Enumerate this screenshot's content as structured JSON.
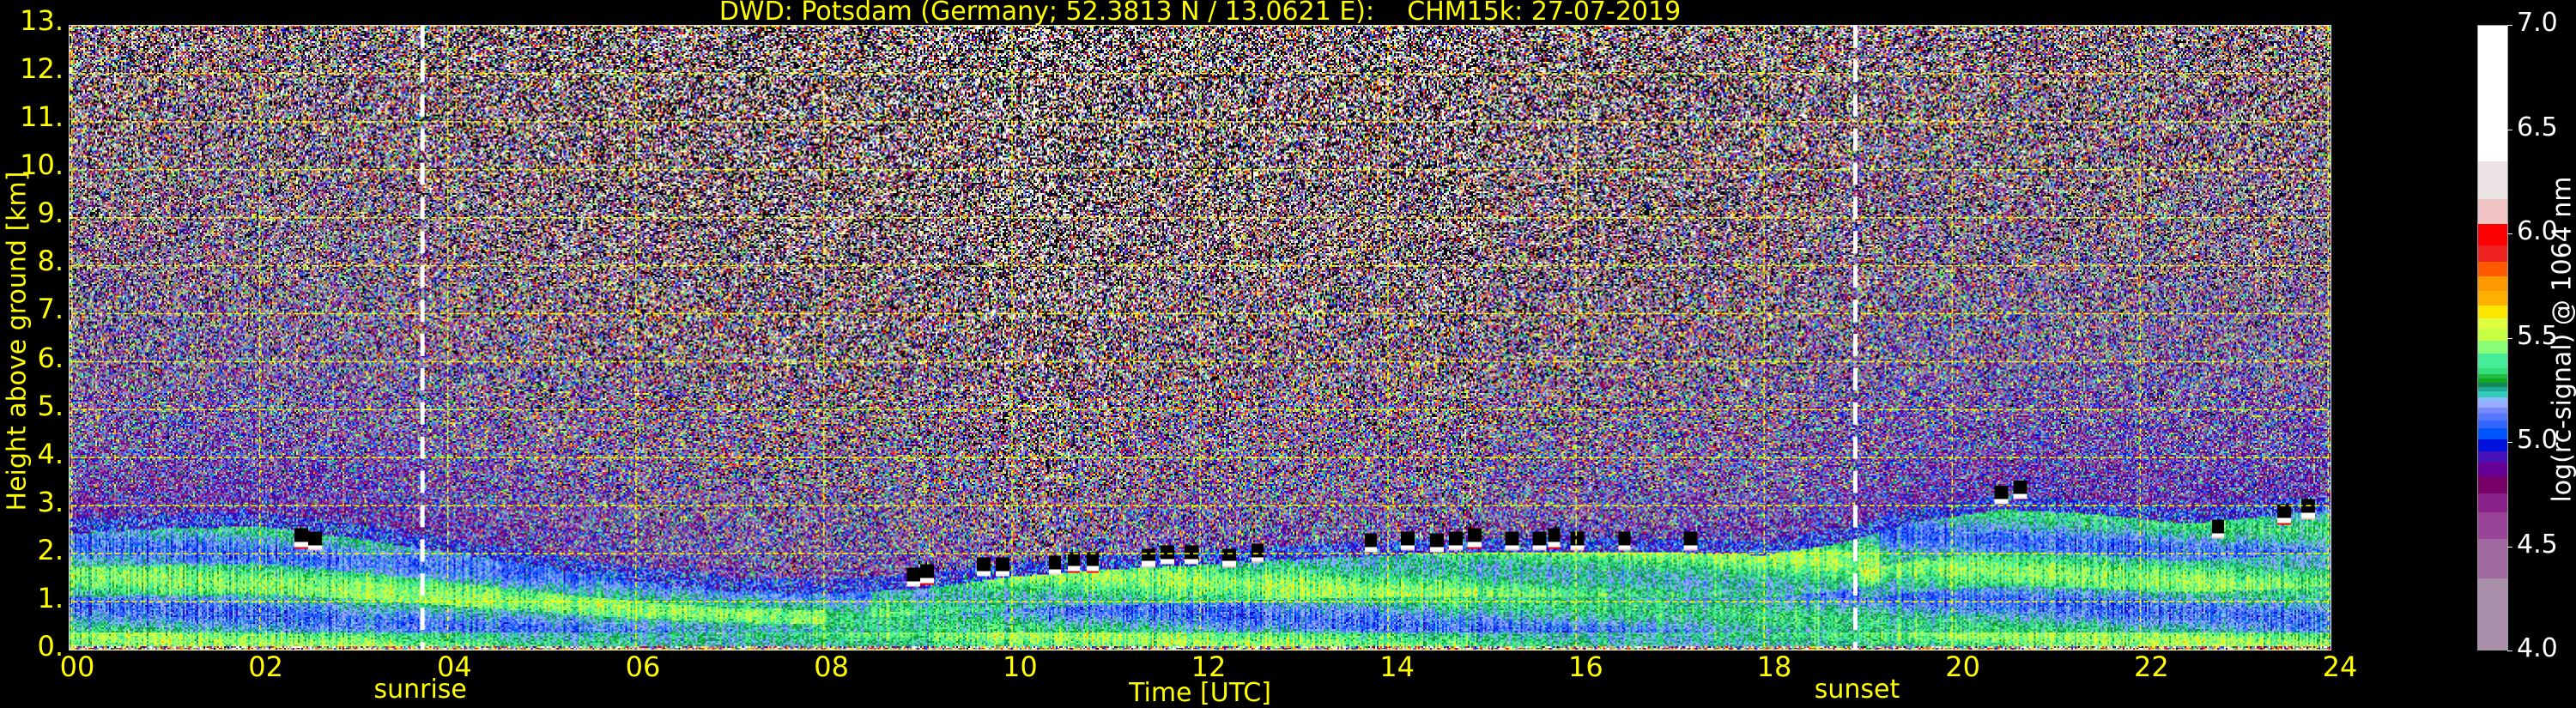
{
  "chart_data": {
    "type": "heatmap",
    "title": "DWD: Potsdam (Germany; 52.3813 N / 13.0621 E):    CHM15k: 27-07-2019",
    "xlabel": "Time [UTC]",
    "ylabel": "Height above ground [km]",
    "xlim": [
      0,
      24
    ],
    "ylim": [
      0,
      13
    ],
    "xticks": [
      0,
      2,
      4,
      6,
      8,
      10,
      12,
      14,
      16,
      18,
      20,
      22,
      24
    ],
    "xtick_labels": [
      "00",
      "02",
      "04",
      "06",
      "08",
      "10",
      "12",
      "14",
      "16",
      "18",
      "20",
      "22",
      "24"
    ],
    "yticks": [
      0,
      1,
      2,
      3,
      4,
      5,
      6,
      7,
      8,
      9,
      10,
      11,
      12,
      13
    ],
    "ytick_labels": [
      "0.",
      "1.",
      "2.",
      "3.",
      "4.",
      "5.",
      "6.",
      "7.",
      "8.",
      "9.",
      "10.",
      "11.",
      "12.",
      "13."
    ],
    "grid": true,
    "markers": [
      {
        "label": "sunrise",
        "x": 3.73
      },
      {
        "label": "sunset",
        "x": 18.97
      }
    ],
    "boundary_layer_top_km": {
      "t": [
        0,
        1,
        2,
        3,
        4,
        5,
        6,
        7,
        8,
        9,
        10,
        11,
        12,
        13,
        14,
        15,
        16,
        17,
        18,
        18.8,
        19.5,
        20.5,
        21.5,
        22.5,
        23.5,
        24
      ],
      "h": [
        2.4,
        2.5,
        2.55,
        2.3,
        2.0,
        1.7,
        1.4,
        1.2,
        1.15,
        1.25,
        1.5,
        1.65,
        1.75,
        1.85,
        1.95,
        2.0,
        2.0,
        2.0,
        1.95,
        2.2,
        2.6,
        2.9,
        2.8,
        2.6,
        2.8,
        2.9
      ]
    },
    "cloud_base_points": [
      {
        "t": 2.45,
        "h": 2.1
      },
      {
        "t": 2.6,
        "h": 2.05
      },
      {
        "t": 8.95,
        "h": 1.3
      },
      {
        "t": 9.1,
        "h": 1.35
      },
      {
        "t": 9.7,
        "h": 1.5
      },
      {
        "t": 9.9,
        "h": 1.5
      },
      {
        "t": 10.45,
        "h": 1.55
      },
      {
        "t": 10.65,
        "h": 1.6
      },
      {
        "t": 10.85,
        "h": 1.6
      },
      {
        "t": 11.45,
        "h": 1.7
      },
      {
        "t": 11.65,
        "h": 1.75
      },
      {
        "t": 11.9,
        "h": 1.75
      },
      {
        "t": 12.3,
        "h": 1.7
      },
      {
        "t": 12.6,
        "h": 1.8
      },
      {
        "t": 13.8,
        "h": 2.0
      },
      {
        "t": 14.2,
        "h": 2.05
      },
      {
        "t": 14.5,
        "h": 2.0
      },
      {
        "t": 14.7,
        "h": 2.05
      },
      {
        "t": 14.9,
        "h": 2.1
      },
      {
        "t": 15.3,
        "h": 2.05
      },
      {
        "t": 15.6,
        "h": 2.05
      },
      {
        "t": 15.75,
        "h": 2.1
      },
      {
        "t": 16.0,
        "h": 2.05
      },
      {
        "t": 16.5,
        "h": 2.05
      },
      {
        "t": 17.2,
        "h": 2.05
      },
      {
        "t": 20.5,
        "h": 3.0
      },
      {
        "t": 20.7,
        "h": 3.1
      },
      {
        "t": 22.8,
        "h": 2.3
      },
      {
        "t": 23.5,
        "h": 2.6
      },
      {
        "t": 23.75,
        "h": 2.7
      }
    ],
    "colorbar": {
      "label": "log(rc-signal) @ 1064 nm",
      "range": [
        4.0,
        7.0
      ],
      "ticks": [
        4.0,
        4.5,
        5.0,
        5.5,
        6.0,
        6.5,
        7.0
      ],
      "tick_labels": [
        "4.0",
        "4.5",
        "5.0",
        "5.5",
        "6.0",
        "6.5",
        "7.0"
      ],
      "bands": [
        [
          4.0,
          4.35,
          "#aa90aa"
        ],
        [
          4.35,
          4.54,
          "#a06a9f"
        ],
        [
          4.54,
          4.67,
          "#994499"
        ],
        [
          4.67,
          4.76,
          "#882288"
        ],
        [
          4.76,
          4.84,
          "#770066"
        ],
        [
          4.84,
          4.91,
          "#660099"
        ],
        [
          4.91,
          4.96,
          "#4411bb"
        ],
        [
          4.96,
          5.02,
          "#0011dd"
        ],
        [
          5.02,
          5.07,
          "#0055ff"
        ],
        [
          5.07,
          5.11,
          "#3366ff"
        ],
        [
          5.11,
          5.14,
          "#5577ff"
        ],
        [
          5.14,
          5.17,
          "#7788ff"
        ],
        [
          5.17,
          5.2,
          "#99aaff"
        ],
        [
          5.2,
          5.22,
          "#88bbff"
        ],
        [
          5.22,
          5.25,
          "#33ccbb"
        ],
        [
          5.25,
          5.27,
          "#22aa99"
        ],
        [
          5.27,
          5.29,
          "#118855"
        ],
        [
          5.29,
          5.31,
          "#11aa22"
        ],
        [
          5.31,
          5.33,
          "#22bb44"
        ],
        [
          5.33,
          5.36,
          "#33dd77"
        ],
        [
          5.36,
          5.4,
          "#44ee99"
        ],
        [
          5.4,
          5.43,
          "#44ee99"
        ],
        [
          5.43,
          5.49,
          "#88ff77"
        ],
        [
          5.49,
          5.55,
          "#c8ff40"
        ],
        [
          5.55,
          5.6,
          "#ddff40"
        ],
        [
          5.6,
          5.66,
          "#ffe600"
        ],
        [
          5.66,
          5.73,
          "#ffb000"
        ],
        [
          5.73,
          5.8,
          "#ff9900"
        ],
        [
          5.8,
          5.87,
          "#ff5a00"
        ],
        [
          5.87,
          5.95,
          "#ee2222"
        ],
        [
          5.95,
          6.05,
          "#ff0000"
        ],
        [
          6.05,
          6.17,
          "#f0c4c4"
        ],
        [
          6.17,
          6.35,
          "#ece4e4"
        ],
        [
          6.35,
          7.0,
          "#ffffff"
        ]
      ]
    }
  },
  "colors": {
    "axis_text": "#ffff00",
    "grid": "#ffff00",
    "marker_line": "#ffffff",
    "background": "#000000"
  }
}
